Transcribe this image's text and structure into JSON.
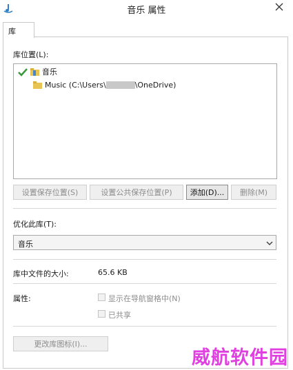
{
  "window": {
    "title": "音乐 属性"
  },
  "tabs": [
    {
      "label": "库"
    }
  ],
  "library_locations": {
    "label": "库位置(L):",
    "items": [
      {
        "name": "音乐",
        "default_save": true
      },
      {
        "prefix": "Music (C:\\Users\\",
        "suffix": "\\OneDrive)"
      }
    ]
  },
  "buttons": {
    "set_save_location": "设置保存位置(S)",
    "set_public_save_location": "设置公共保存位置(P)",
    "add": "添加(D)...",
    "remove": "删除(M)",
    "change_icon": "更改库图标(I)..."
  },
  "optimize": {
    "label": "优化此库(T):",
    "selected": "音乐"
  },
  "size": {
    "label": "库中文件的大小:",
    "value": "65.6 KB"
  },
  "attributes": {
    "label": "属性:",
    "show_in_nav_pane": {
      "label": "显示在导航窗格中(N)",
      "checked": false,
      "enabled": false
    },
    "shared": {
      "label": "已共享",
      "checked": false,
      "enabled": false
    }
  },
  "watermark": "威航软件园",
  "colors": {
    "watermark": "#e040e0",
    "disabled_text": "#8c8c8c"
  }
}
